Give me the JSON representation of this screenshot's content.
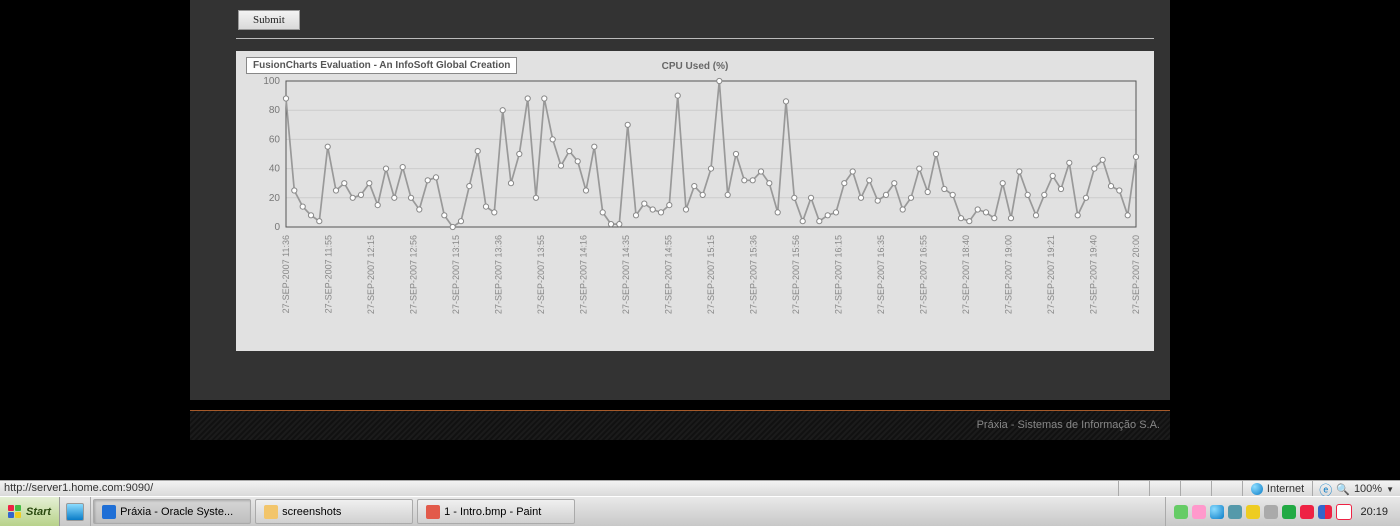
{
  "buttons": {
    "submit": "Submit"
  },
  "badge": "FusionCharts Evaluation - An InfoSoft Global Creation",
  "footer": "Práxia - Sistemas de Informação S.A.",
  "ie_status": {
    "url": "http://server1.home.com:9090/",
    "zone": "Internet",
    "zoom": "100%"
  },
  "taskbar": {
    "start": "Start",
    "tasks": [
      {
        "label": "Práxia - Oracle Syste...",
        "icon": "#1f6fd6"
      },
      {
        "label": "screenshots",
        "icon": "#f2c56b"
      },
      {
        "label": "1 - Intro.bmp - Paint",
        "icon": "#e25a4a"
      }
    ],
    "clock": "20:19"
  },
  "chart_data": {
    "type": "line",
    "title": "CPU Used (%)",
    "xlabel": "",
    "ylabel": "",
    "ylim": [
      0,
      100
    ],
    "yticks": [
      0,
      20,
      40,
      60,
      80,
      100
    ],
    "categories": [
      "27-SEP-2007 11:36",
      "27-SEP-2007 11:55",
      "27-SEP-2007 12:15",
      "27-SEP-2007 12:56",
      "27-SEP-2007 13:15",
      "27-SEP-2007 13:36",
      "27-SEP-2007 13:55",
      "27-SEP-2007 14:16",
      "27-SEP-2007 14:35",
      "27-SEP-2007 14:55",
      "27-SEP-2007 15:15",
      "27-SEP-2007 15:36",
      "27-SEP-2007 15:56",
      "27-SEP-2007 16:15",
      "27-SEP-2007 16:35",
      "27-SEP-2007 16:55",
      "27-SEP-2007 18:40",
      "27-SEP-2007 19:00",
      "27-SEP-2007 19:21",
      "27-SEP-2007 19:40",
      "27-SEP-2007 20:00"
    ],
    "values": [
      88,
      25,
      14,
      8,
      4,
      55,
      25,
      30,
      20,
      22,
      30,
      15,
      40,
      20,
      41,
      20,
      12,
      32,
      34,
      8,
      0,
      4,
      28,
      52,
      14,
      10,
      80,
      30,
      50,
      88,
      20,
      88,
      60,
      42,
      52,
      45,
      25,
      55,
      10,
      2,
      2,
      70,
      8,
      16,
      12,
      10,
      15,
      90,
      12,
      28,
      22,
      40,
      100,
      22,
      50,
      32,
      32,
      38,
      30,
      10,
      86,
      20,
      4,
      20,
      4,
      8,
      10,
      30,
      38,
      20,
      32,
      18,
      22,
      30,
      12,
      20,
      40,
      24,
      50,
      26,
      22,
      6,
      4,
      12,
      10,
      6,
      30,
      6,
      38,
      22,
      8,
      22,
      35,
      26,
      44,
      8,
      20,
      40,
      46,
      28,
      25,
      8,
      48
    ]
  }
}
